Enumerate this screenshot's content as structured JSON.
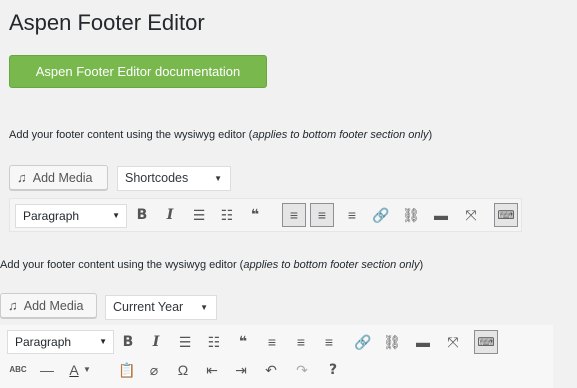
{
  "page_title": "Aspen Footer Editor",
  "documentation_button": "Aspen Footer Editor documentation",
  "description": {
    "text": "Add your footer content using the wysiwyg editor (",
    "note": "applies to bottom footer section only",
    "close": ")"
  },
  "editor1": {
    "add_media_label": "Add Media",
    "shortcode_select": "Shortcodes",
    "format_select": "Paragraph"
  },
  "editor2": {
    "add_media_label": "Add Media",
    "shortcode_select": "Current Year",
    "format_select": "Paragraph"
  },
  "toolbar_icons": {
    "bold": "B",
    "italic": "I",
    "bullet_list": "☰",
    "numbered_list": "☷",
    "blockquote": "❝",
    "align_left": "≡",
    "align_center": "≡",
    "align_right": "≡",
    "link": "🔗",
    "unlink": "⛓",
    "read_more": "▬",
    "fullscreen": "⤧",
    "toolbar_toggle": "⌨",
    "strikethrough": "ABC",
    "hr": "—",
    "text_color": "A",
    "paste_text": "📋",
    "clear_format": "⌀",
    "special_char": "Ω",
    "outdent": "⇤",
    "indent": "⇥",
    "undo": "↶",
    "redo": "↷",
    "help": "?"
  },
  "colors": {
    "accent_button": "#78b84d",
    "text": "#23282d"
  }
}
